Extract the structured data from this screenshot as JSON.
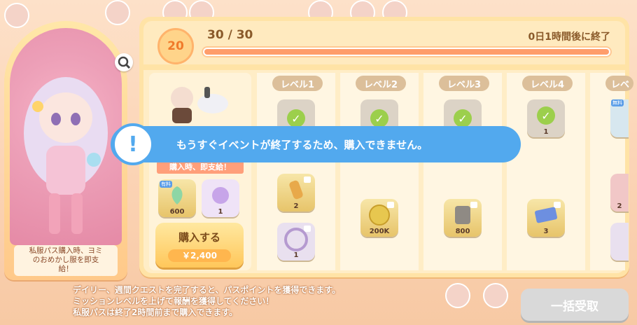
{
  "header": {
    "level": "20",
    "progress_text": "30 / 30",
    "progress_fraction": 1.0,
    "end_text": "0日1時間後に終了"
  },
  "character": {
    "caption_line1": "私服パス購入時、ヨミ",
    "caption_line2": "のおめかし服を即支",
    "caption_line3": "給！"
  },
  "levels": [
    {
      "label": "レベル1",
      "top": {
        "state": "claimed"
      },
      "bottom": [
        {
          "count": "2"
        },
        {
          "count": "1"
        }
      ]
    },
    {
      "label": "レベル2",
      "top": {
        "state": "claimed"
      },
      "bottom": [
        {
          "count": "200K"
        }
      ]
    },
    {
      "label": "レベル3",
      "top": {
        "state": "claimed"
      },
      "bottom": [
        {
          "count": "800"
        }
      ]
    },
    {
      "label": "レベル4",
      "top": {
        "state": "claimed",
        "count": "1"
      },
      "bottom": [
        {
          "count": "3"
        }
      ]
    },
    {
      "label": "レベ",
      "top": {
        "state": "locked",
        "badge": "無料"
      },
      "bottom": [
        {
          "count": "2"
        }
      ]
    }
  ],
  "pass": {
    "ribbon": "購入時、即支給！",
    "items": [
      {
        "badge": "有料",
        "count": "600"
      },
      {
        "count": "1"
      }
    ],
    "buy_label": "購入する",
    "price": "￥2,400"
  },
  "banner": {
    "text": "もうすぐイベントが終了するため、購入できません。",
    "icon": "exclamation-icon"
  },
  "footer": {
    "line1": "デイリー、週間クエストを完了すると、パスポイントを獲得できます。",
    "line2": "ミッションレベルを上げて報酬を獲得してください！",
    "line3": "私服パスは終了2時間前まで購入できます。",
    "collect_label": "一括受取"
  },
  "colors": {
    "accent": "#ff9d6b",
    "banner": "#52a9ee",
    "check": "#9ccf4c"
  }
}
